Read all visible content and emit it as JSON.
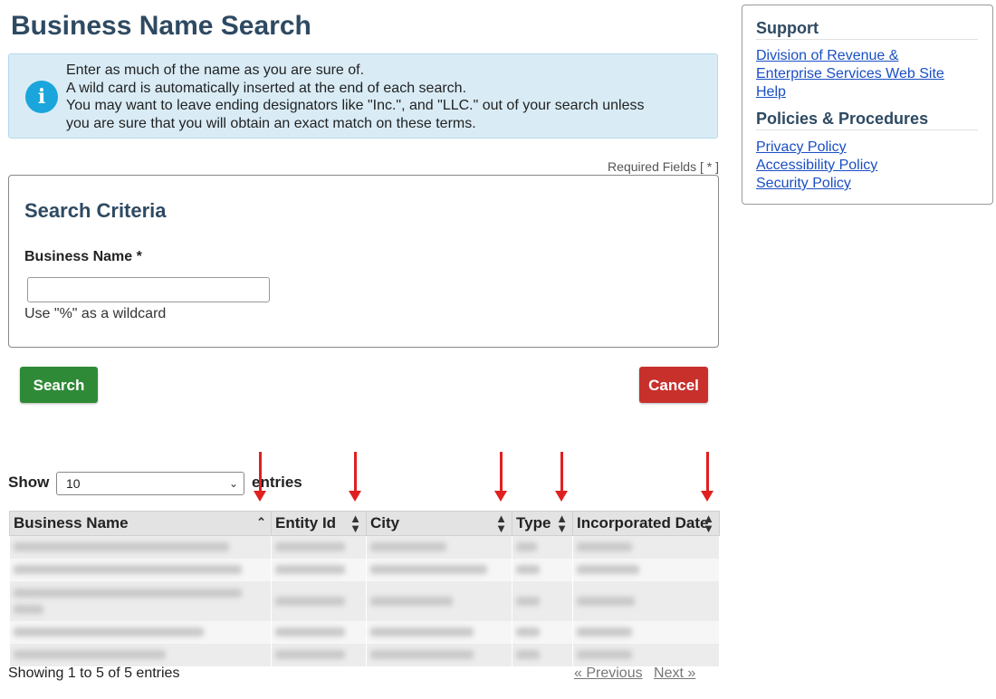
{
  "page": {
    "title": "Business Name Search"
  },
  "info": {
    "icon": "info-icon",
    "lines": [
      "Enter as much of the name as you are sure of.",
      "A wild card is automatically inserted at the end of each search.",
      "You may want to leave ending designators like \"Inc.\", and \"LLC.\" out of your search unless",
      "you are sure that you will obtain an exact match on these terms."
    ]
  },
  "required_note": "Required Fields [ * ]",
  "criteria": {
    "heading": "Search Criteria",
    "business_name_label": "Business Name *",
    "business_name_value": "",
    "hint": "Use \"%\" as a wildcard"
  },
  "buttons": {
    "search": "Search",
    "cancel": "Cancel"
  },
  "table_controls": {
    "show": "Show",
    "page_size": "10",
    "entries": "entries"
  },
  "table": {
    "columns": [
      "Business Name",
      "Entity Id",
      "City",
      "Type",
      "Incorporated Date"
    ],
    "row_count_visible": 5
  },
  "footer": {
    "info": "Showing 1 to 5 of 5 entries",
    "previous": "« Previous",
    "next": "Next »"
  },
  "sidebar": {
    "support_heading": "Support",
    "support_links": [
      "Division of Revenue &",
      "Enterprise Services Web Site",
      "Help"
    ],
    "policies_heading": "Policies & Procedures",
    "policy_links": [
      "Privacy Policy",
      "Accessibility Policy",
      "Security Policy"
    ]
  },
  "colors": {
    "accent": "#2e4a62",
    "search": "#2f8a37",
    "cancel": "#c8302c",
    "info_bg": "#d9ecf6",
    "annotation": "#e02020"
  }
}
